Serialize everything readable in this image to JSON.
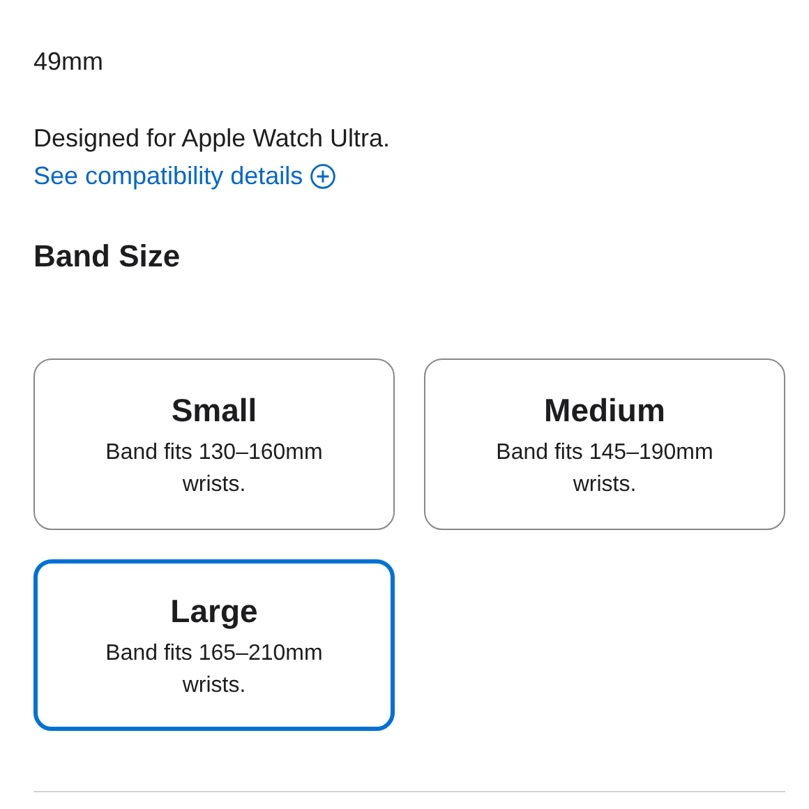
{
  "case_size": "49mm",
  "compatibility": {
    "note": "Designed for Apple Watch Ultra.",
    "link": "See compatibility details"
  },
  "band_size": {
    "title": "Band Size",
    "options": [
      {
        "label": "Small",
        "description": "Band fits 130–160mm wrists.",
        "selected": false
      },
      {
        "label": "Medium",
        "description": "Band fits 145–190mm wrists.",
        "selected": false
      },
      {
        "label": "Large",
        "description": "Band fits 165–210mm wrists.",
        "selected": true
      }
    ]
  }
}
